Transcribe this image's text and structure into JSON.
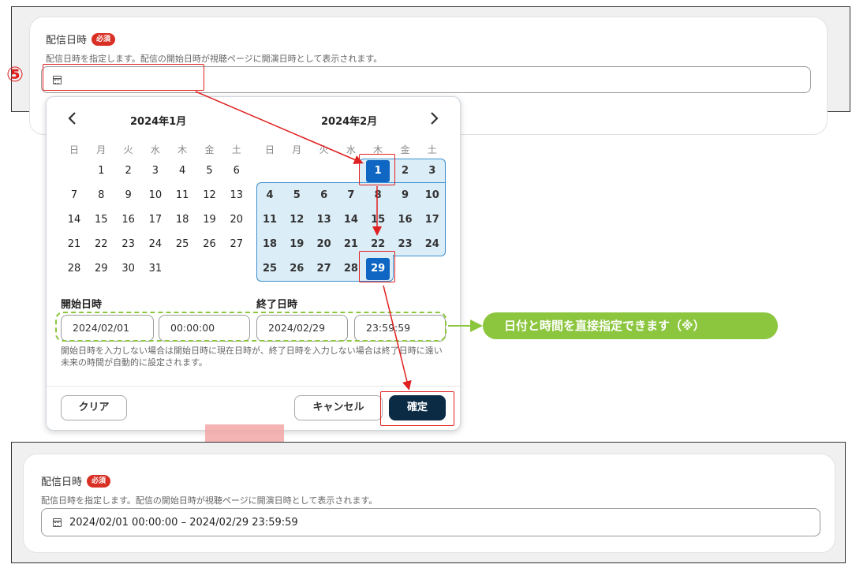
{
  "top_panel": {
    "label": "配信日時",
    "required_badge": "必須",
    "help": "配信日時を指定します。配信の開始日時が視聴ページに開演日時として表示されます。",
    "input_value": ""
  },
  "step_marker": "⑤",
  "calendar": {
    "prev_icon": "chevron-left-icon",
    "next_icon": "chevron-right-icon",
    "weekdays": [
      "日",
      "月",
      "火",
      "水",
      "木",
      "金",
      "土"
    ],
    "left_month": {
      "title": "2024年1月",
      "days": [
        "1",
        "2",
        "3",
        "4",
        "5",
        "6",
        "7",
        "8",
        "9",
        "10",
        "11",
        "12",
        "13",
        "14",
        "15",
        "16",
        "17",
        "18",
        "19",
        "20",
        "21",
        "22",
        "23",
        "24",
        "25",
        "26",
        "27",
        "28",
        "29",
        "30",
        "31"
      ]
    },
    "right_month": {
      "title": "2024年2月",
      "days": [
        "1",
        "2",
        "3",
        "4",
        "5",
        "6",
        "7",
        "8",
        "9",
        "10",
        "11",
        "12",
        "13",
        "14",
        "15",
        "16",
        "17",
        "18",
        "19",
        "20",
        "21",
        "22",
        "23",
        "24",
        "25",
        "26",
        "27",
        "28",
        "29"
      ]
    },
    "selected_start": "1",
    "selected_end": "29"
  },
  "datetime": {
    "start_label": "開始日時",
    "end_label": "終了日時",
    "start_date": "2024/02/01",
    "start_time": "00:00:00",
    "end_date": "2024/02/29",
    "end_time": "23:59:59",
    "note": "開始日時を入力しない場合は開始日時に現在日時が、終了日時を入力しない場合は終了日時に遠い未来の時間が自動的に設定されます。"
  },
  "buttons": {
    "clear": "クリア",
    "cancel": "キャンセル",
    "confirm": "確定"
  },
  "callout": "日付と時間を直接指定できます（※）",
  "bottom_panel": {
    "label": "配信日時",
    "required_badge": "必須",
    "help": "配信日時を指定します。配信の開始日時が視聴ページに開演日時として表示されます。",
    "input_value": "2024/02/01 00:00:00 – 2024/02/29 23:59:59"
  },
  "colors": {
    "accent": "#1067c3",
    "range": "#dbedf7",
    "annotation_red": "#e02020",
    "callout_green": "#8cc63f",
    "confirm_dark": "#0b2b45",
    "required_red": "#d93025"
  }
}
